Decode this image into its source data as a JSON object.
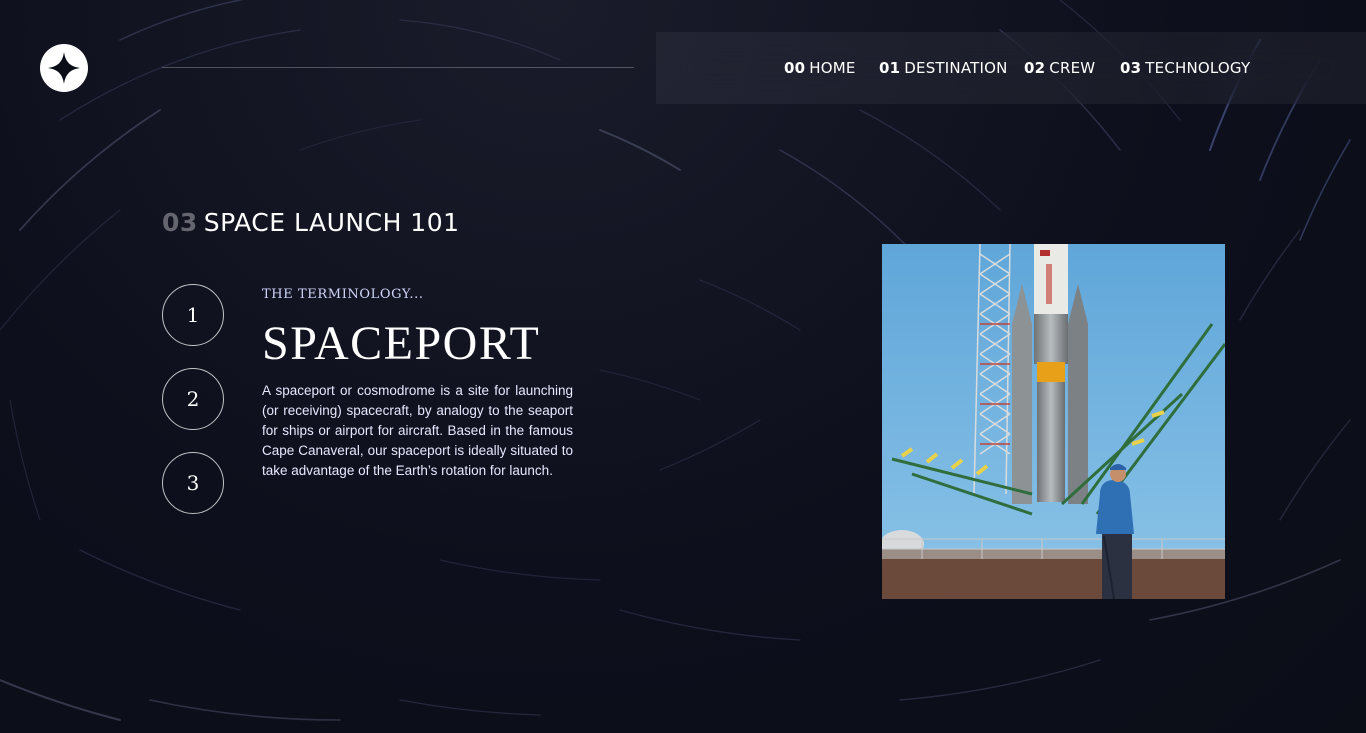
{
  "nav": {
    "items": [
      {
        "num": "00",
        "label": "HOME"
      },
      {
        "num": "01",
        "label": "DESTINATION"
      },
      {
        "num": "02",
        "label": "CREW"
      },
      {
        "num": "03",
        "label": "TECHNOLOGY"
      }
    ]
  },
  "page": {
    "heading_num": "03",
    "heading": "SPACE LAUNCH 101"
  },
  "steps": [
    "1",
    "2",
    "3"
  ],
  "technology": {
    "subheading": "THE TERMINOLOGY...",
    "title": "SPACEPORT",
    "description": "A spaceport or cosmodrome is a site for launching (or receiving) spacecraft, by analogy to the seaport for ships or airport for aircraft. Based in the famous Cape Canaveral, our spaceport is ideally situated to take advantage of the Earth’s rotation for launch.",
    "image_subject": "spaceport-launch-pad-photo"
  },
  "colors": {
    "background": "#0b0d17",
    "accent_light": "#d0d6f9",
    "nav_bg": "rgba(255,255,255,0.05)"
  }
}
